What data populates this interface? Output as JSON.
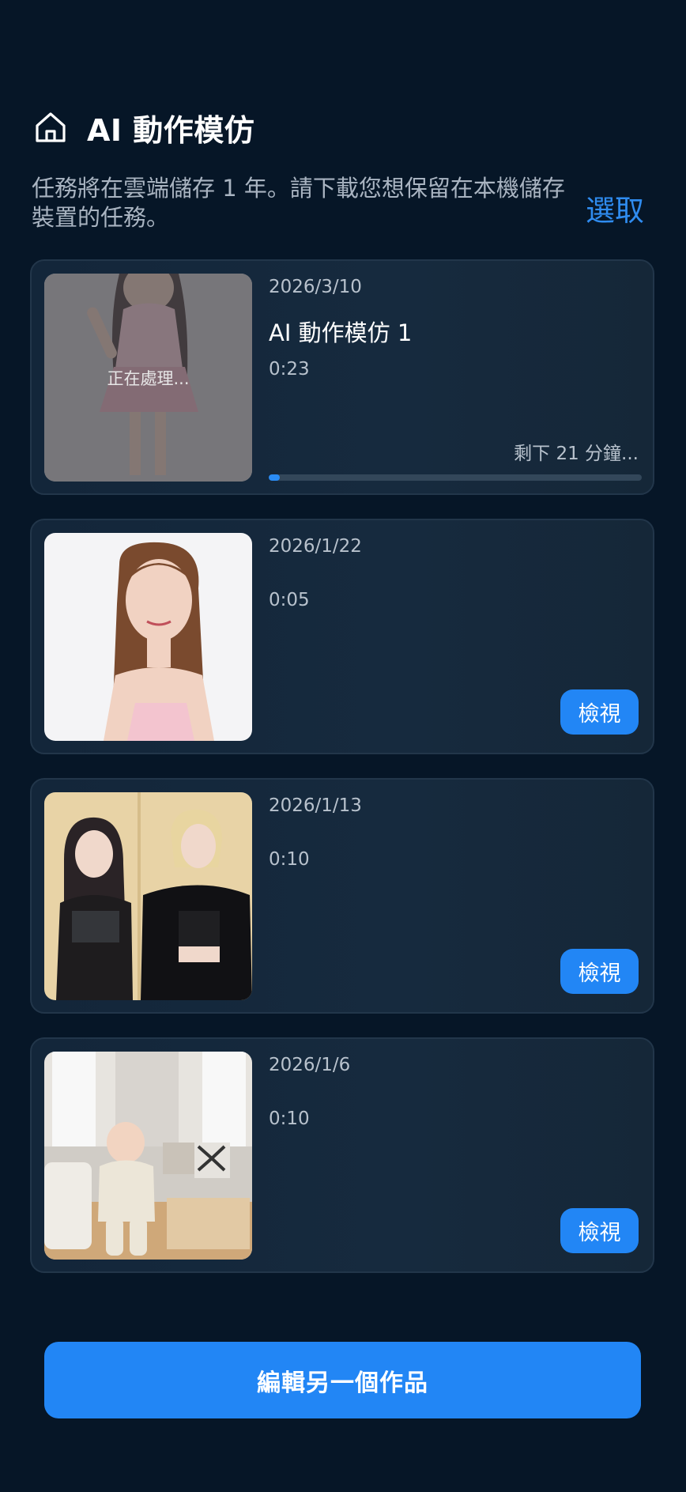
{
  "header": {
    "icon": "home-icon",
    "title": "AI 動作模仿"
  },
  "intro": {
    "text": "任務將在雲端儲存 1 年。請下載您想保留在本機儲存裝置的任務。",
    "select_label": "選取"
  },
  "tasks": [
    {
      "date": "2026/3/10",
      "name": "AI 動作模仿 1",
      "duration": "0:23",
      "status_overlay": "正在處理...",
      "remaining": "剩下 21 分鐘...",
      "progress_percent": 3
    },
    {
      "date": "2026/1/22",
      "duration": "0:05",
      "view_label": "檢視"
    },
    {
      "date": "2026/1/13",
      "duration": "0:10",
      "view_label": "檢視"
    },
    {
      "date": "2026/1/6",
      "duration": "0:10",
      "view_label": "檢視"
    }
  ],
  "footer": {
    "edit_another_label": "編輯另一個作品"
  },
  "colors": {
    "background": "#061627",
    "card": "#14273b",
    "accent": "#2286f5",
    "muted_text": "#b8c2cd"
  }
}
